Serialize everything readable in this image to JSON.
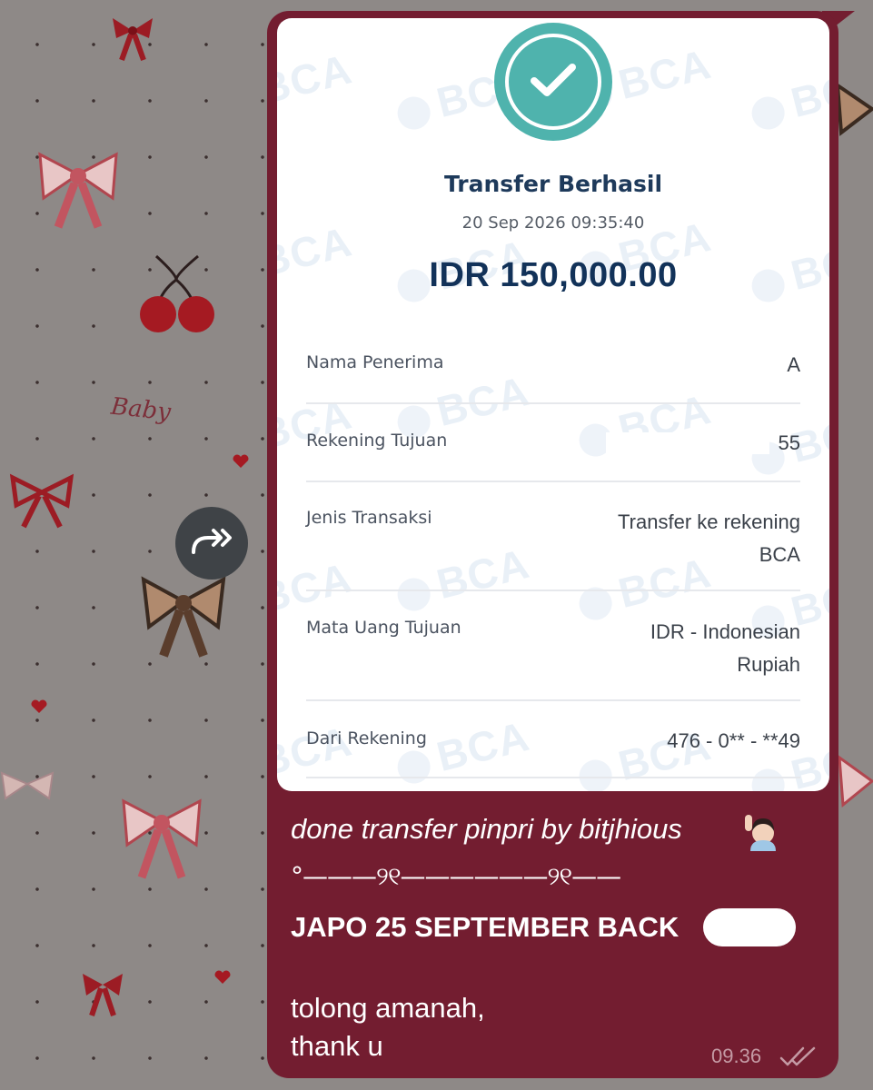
{
  "receipt": {
    "watermark": "BCA",
    "title": "Transfer Berhasil",
    "datetime": "20 Sep 2026 09:35:40",
    "amount": "IDR 150,000.00",
    "rows": [
      {
        "label": "Nama Penerima",
        "value": "A"
      },
      {
        "label": "Rekening Tujuan",
        "value": "55"
      },
      {
        "label": "Jenis Transaksi",
        "value_line1": "Transfer ke rekening",
        "value_line2": "BCA"
      },
      {
        "label": "Mata Uang Tujuan",
        "value_line1": "IDR - Indonesian",
        "value_line2": "Rupiah"
      },
      {
        "label": "Dari Rekening",
        "value": "476 - 0** - **49"
      }
    ]
  },
  "message": {
    "line1": "done transfer pinpri by bitjhious",
    "line1_emoji": "raising-hand-emoji",
    "divider": "°———୨୧——————୨୧——",
    "line2": "JAPO 25 SEPTEMBER BACK",
    "line3": "tolong amanah,",
    "line4": "thank u",
    "time": "09.36",
    "status_icon": "double-check-icon"
  },
  "wallpaper_text": "Baby",
  "colors": {
    "bubble": "#731d30",
    "check": "#4fb3ad",
    "navy": "#123259",
    "wallpaper": "#8e8987"
  },
  "icons": [
    "forward-icon",
    "checkmark-icon",
    "bow-icon",
    "cherry-icon",
    "heart-icon"
  ]
}
